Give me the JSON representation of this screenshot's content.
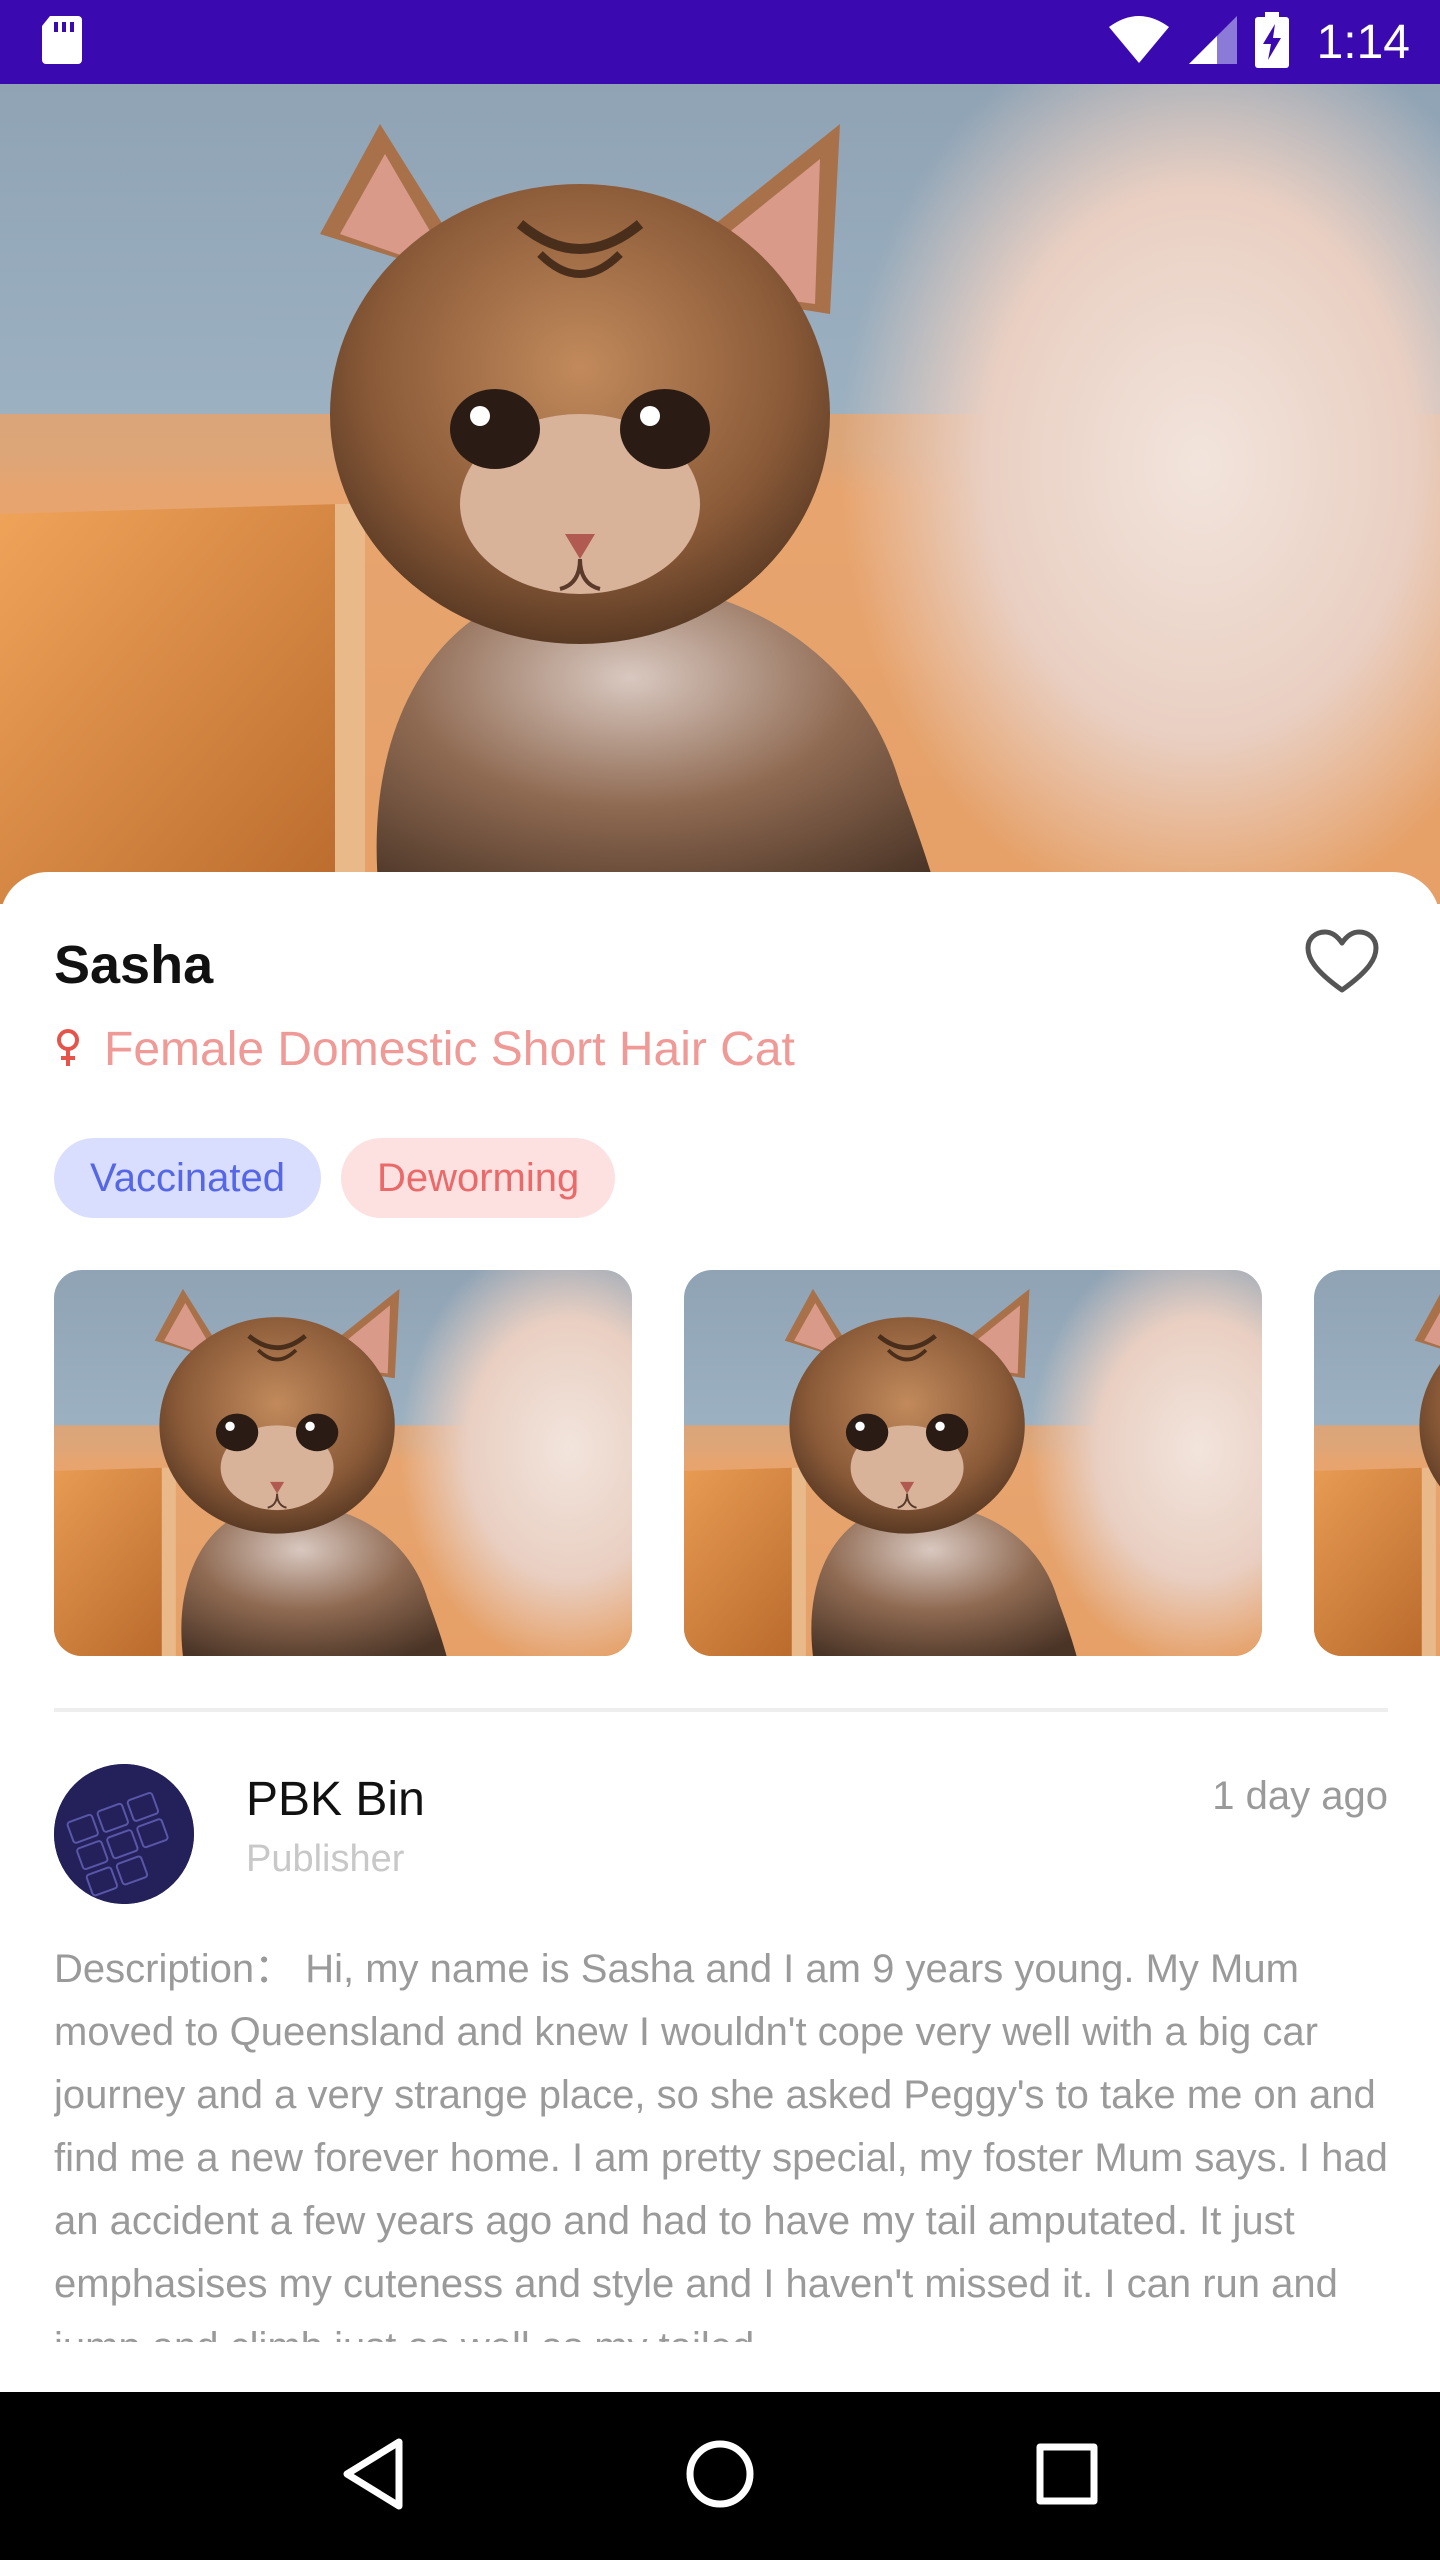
{
  "status_bar": {
    "time": "1:14",
    "icons": [
      "sd-card-icon",
      "wifi-icon",
      "cellular-signal-icon",
      "battery-charging-icon"
    ],
    "background": "#3a0ab0"
  },
  "pet": {
    "name": "Sasha",
    "gender_icon": "female-icon",
    "breed_line": "Female Domestic Short Hair Cat",
    "favorite_icon": "heart-outline-icon",
    "tags": [
      {
        "label": "Vaccinated",
        "color": "#5566e6",
        "background": "#d9defe"
      },
      {
        "label": "Deworming",
        "color": "#ea6a6a",
        "background": "#fde1e1"
      }
    ],
    "gallery_count_visible": 3
  },
  "publisher": {
    "name": "PBK Bin",
    "role": "Publisher",
    "posted": "1 day ago"
  },
  "description": "Description： Hi, my name is Sasha and I am 9 years young. My Mum moved to Queensland and knew I wouldn't cope very well with a big car journey and a very strange place, so she asked Peggy's to take me on and find me a new forever home. I am pretty special, my foster Mum says. I had an accident a few years ago and had to have my tail amputated. It just emphasises my cuteness and style and I haven't missed it. I can run and jump and climb just as well as my tailed",
  "nav_bar": {
    "buttons": [
      "back-icon",
      "home-icon",
      "recents-icon"
    ]
  },
  "colors": {
    "breed_text": "#f09a97",
    "muted_text": "#9a9a9a"
  }
}
